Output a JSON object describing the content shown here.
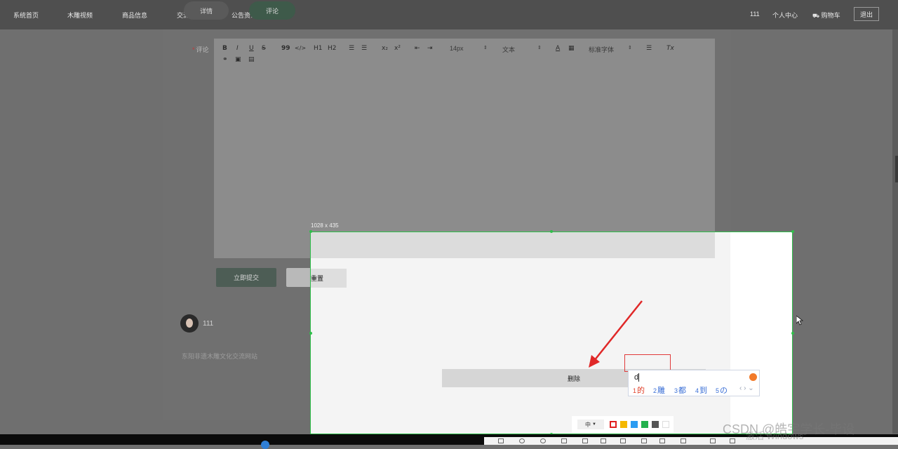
{
  "nav": {
    "items": [
      "系统首页",
      "木雕视频",
      "商品信息",
      "交流论坛",
      "公告资讯"
    ],
    "user": "111",
    "profile": "个人中心",
    "cart": "购物车",
    "logout": "退出"
  },
  "tabs": [
    "详情",
    "评论"
  ],
  "form": {
    "label": "评论",
    "required_mark": "*",
    "toolbar": {
      "bold": "B",
      "italic": "I",
      "underline": "U",
      "strike": "S",
      "quote": "99",
      "code": "</>",
      "h1": "H1",
      "h2": "H2",
      "sub": "x₂",
      "sup": "x²",
      "size": "14px",
      "format": "文本",
      "font": "标准字体",
      "clear": "Tx",
      "color": "A"
    },
    "submit": "立即提交",
    "reset": "重置"
  },
  "comment": {
    "user": "111"
  },
  "footer": "东阳非遗木雕文化交流网站",
  "capture": {
    "size": "1028 x 435",
    "delete": "删除",
    "reset_fragment": "重置"
  },
  "ime": {
    "input": "d",
    "candidates": [
      {
        "num": "1",
        "text": "的"
      },
      {
        "num": "2",
        "text": "雕"
      },
      {
        "num": "3",
        "text": "都"
      },
      {
        "num": "4",
        "text": "到"
      },
      {
        "num": "5",
        "text": "の"
      }
    ]
  },
  "colorbar": {
    "lang": "中",
    "colors": [
      "#e02020",
      "#f5b800",
      "#2b9cf2",
      "#23b14d",
      "#555555",
      "#ffffff"
    ]
  },
  "watermarks": {
    "csdn": "CSDN @皓宇学长-毕设",
    "windows": "激活 Windows"
  }
}
